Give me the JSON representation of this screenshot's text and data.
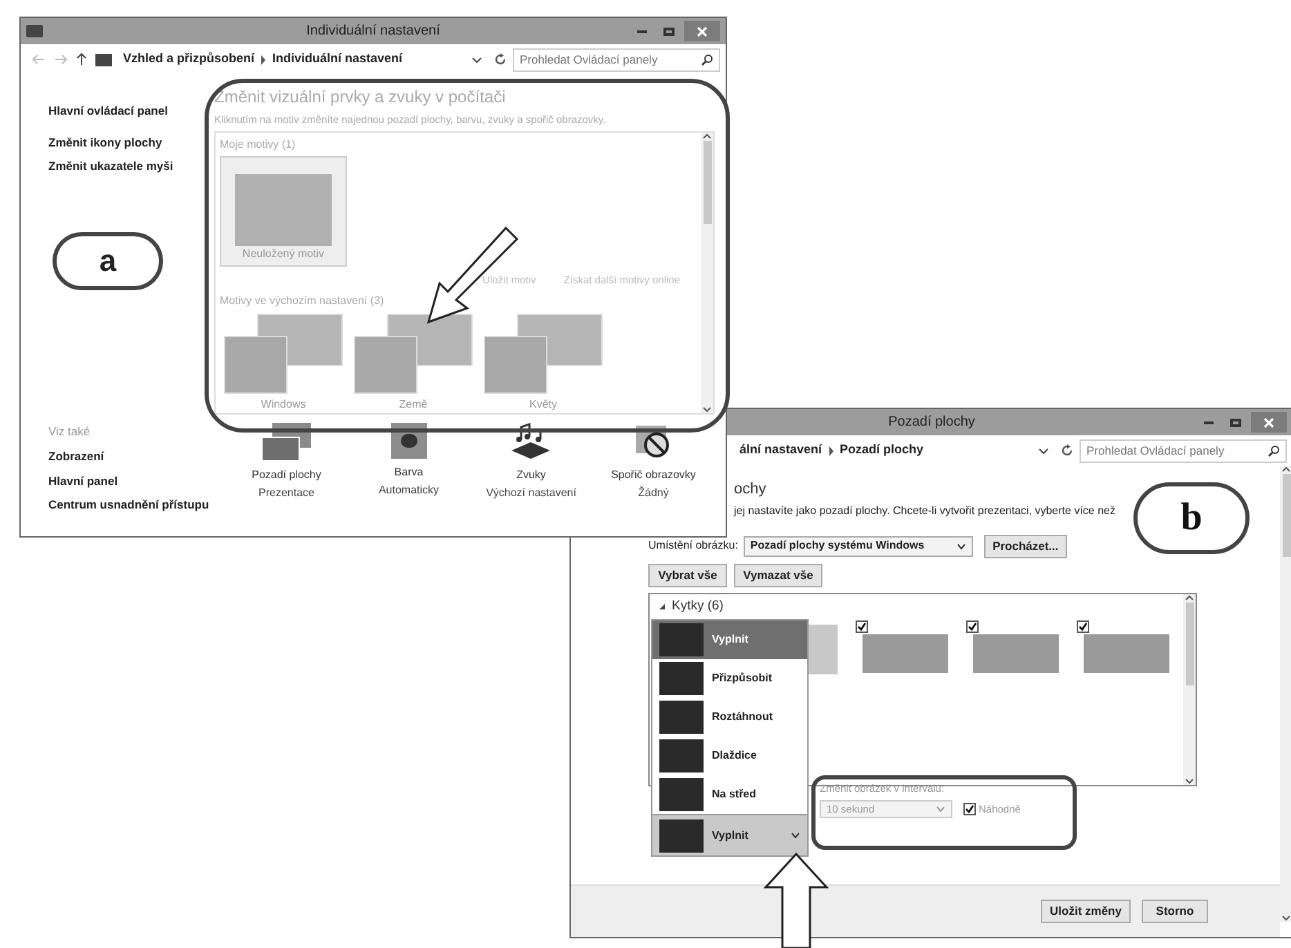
{
  "window_a": {
    "title": "Individuální nastavení",
    "breadcrumb": [
      "Vzhled a přizpůsobení",
      "Individuální nastavení"
    ],
    "search": {
      "placeholder": "Prohledat Ovládací panely"
    },
    "sidebar": {
      "links": [
        "Hlavní ovládací panel",
        "Změnit ikony plochy",
        "Změnit ukazatele myši"
      ],
      "see_also": {
        "title": "Viz také",
        "links": [
          "Zobrazení",
          "Hlavní panel",
          "Centrum usnadnění přístupu"
        ]
      }
    },
    "heading": "Změnit vizuální prvky a zvuky v počítači",
    "description": "Kliknutím na motiv změníte najednou pozadí plochy, barvu, zvuky a spořič obrazovky.",
    "my_themes": {
      "title": "Moje motivy (1)",
      "themes": [
        "Neuložený motiv"
      ],
      "links": [
        "Uložit motiv",
        "Získat další motivy online"
      ]
    },
    "default_themes": {
      "title": "Motivy ve výchozím nastavení (3)",
      "themes": [
        "Windows",
        "Země",
        "Květy"
      ]
    },
    "settings": [
      {
        "kind": "background",
        "name": "Pozadí plochy",
        "value": "Prezentace"
      },
      {
        "kind": "color",
        "name": "Barva",
        "value": "Automaticky"
      },
      {
        "kind": "sounds",
        "name": "Zvuky",
        "value": "Výchozí nastavení"
      },
      {
        "kind": "screensaver",
        "name": "Spořič obrazovky",
        "value": "Žádný"
      }
    ]
  },
  "window_b": {
    "title": "Pozadí plochy",
    "breadcrumb": [
      "ální nastavení",
      "Pozadí plochy"
    ],
    "search": {
      "placeholder": "Prohledat Ovládací panely"
    },
    "heading": "ochy",
    "description": "jej nastavíte jako pozadí plochy. Chcete-li vytvořit prezentaci, vyberte více než",
    "location": {
      "label": "Umístění obrázku:",
      "value": "Pozadí plochy systému Windows",
      "browse": "Procházet..."
    },
    "select_all": "Vybrat vše",
    "clear_all": "Vymazat vše",
    "gallery": {
      "group": "Kytky (6)",
      "expanded": true,
      "pictures": [
        {
          "kind": "partial"
        },
        {
          "kind": "full",
          "checked": true
        },
        {
          "kind": "full",
          "checked": true
        },
        {
          "kind": "full",
          "checked": true
        }
      ]
    },
    "position": {
      "options": [
        {
          "label": "Vyplnit",
          "selected": true
        },
        {
          "label": "Přizpůsobit",
          "selected": false
        },
        {
          "label": "Roztáhnout",
          "selected": false
        },
        {
          "label": "Dlaždice",
          "selected": false
        },
        {
          "label": "Na střed",
          "selected": false
        }
      ],
      "value": "Vyplnit",
      "expanded": true
    },
    "interval": {
      "disabled": true,
      "label": "Změnit obrázek v intervalu:",
      "value": "10 sekund",
      "shuffle": {
        "label": "Náhodně",
        "checked": true
      }
    },
    "buttons": [
      "Uložit změny",
      "Storno"
    ]
  },
  "annotations": {
    "label_a": "a",
    "label_b": "b"
  }
}
